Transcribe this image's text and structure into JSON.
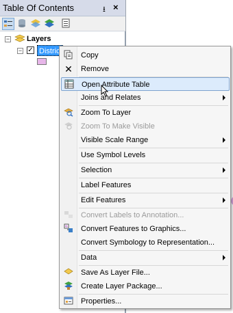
{
  "toc": {
    "title": "Table Of Contents",
    "pin_glyph": "࿔",
    "close_glyph": "×",
    "toolbar": [
      "list-by-drawing-order-icon",
      "list-by-source-icon",
      "list-by-visibility-icon",
      "list-by-selection-icon",
      "options-icon"
    ],
    "layers_label": "Layers",
    "layer_name": "Districts",
    "layer_name_visible": "Distric",
    "layer_checked": true
  },
  "menu": {
    "items": [
      {
        "label": "Copy",
        "icon": "copy-icon",
        "enabled": true,
        "submenu": false
      },
      {
        "label": "Remove",
        "icon": "remove-icon",
        "enabled": true,
        "submenu": false
      },
      {
        "label": "Open Attribute Table",
        "icon": "attribute-table-icon",
        "enabled": true,
        "submenu": false,
        "highlighted": true
      },
      {
        "label": "Joins and Relates",
        "icon": "",
        "enabled": true,
        "submenu": true
      },
      {
        "label": "Zoom To Layer",
        "icon": "zoom-to-layer-icon",
        "enabled": true,
        "submenu": false
      },
      {
        "label": "Zoom To Make Visible",
        "icon": "zoom-visible-icon",
        "enabled": false,
        "submenu": false
      },
      {
        "label": "Visible Scale Range",
        "icon": "",
        "enabled": true,
        "submenu": true
      },
      {
        "label": "Use Symbol Levels",
        "icon": "",
        "enabled": true,
        "submenu": false
      },
      {
        "label": "Selection",
        "icon": "",
        "enabled": true,
        "submenu": true
      },
      {
        "label": "Label Features",
        "icon": "",
        "enabled": true,
        "submenu": false
      },
      {
        "label": "Edit Features",
        "icon": "",
        "enabled": true,
        "submenu": true
      },
      {
        "label": "Convert Labels to Annotation...",
        "icon": "convert-labels-icon",
        "enabled": false,
        "submenu": false
      },
      {
        "label": "Convert Features to Graphics...",
        "icon": "convert-graphics-icon",
        "enabled": true,
        "submenu": false
      },
      {
        "label": "Convert Symbology to Representation...",
        "icon": "",
        "enabled": true,
        "submenu": false
      },
      {
        "label": "Data",
        "icon": "",
        "enabled": true,
        "submenu": true
      },
      {
        "label": "Save As Layer File...",
        "icon": "layer-file-icon",
        "enabled": true,
        "submenu": false
      },
      {
        "label": "Create Layer Package...",
        "icon": "layer-package-icon",
        "enabled": true,
        "submenu": false
      },
      {
        "label": "Properties...",
        "icon": "properties-icon",
        "enabled": true,
        "submenu": false
      }
    ]
  },
  "colors": {
    "selection": "#3399ff",
    "highlight": "#dcebfc",
    "layer_symbol": "#e7b6e9"
  }
}
